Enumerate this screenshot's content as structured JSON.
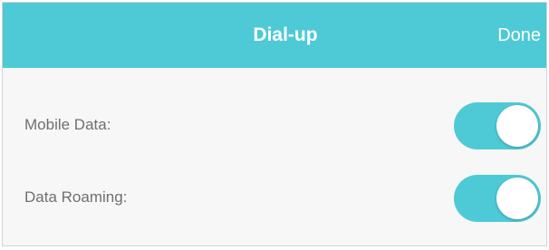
{
  "header": {
    "title": "Dial-up",
    "done_label": "Done"
  },
  "settings": [
    {
      "label": "Mobile Data:",
      "enabled": true
    },
    {
      "label": "Data Roaming:",
      "enabled": true
    }
  ],
  "colors": {
    "accent": "#4ecad6",
    "background": "#f7f7f7",
    "label_text": "#6f6f6f"
  }
}
